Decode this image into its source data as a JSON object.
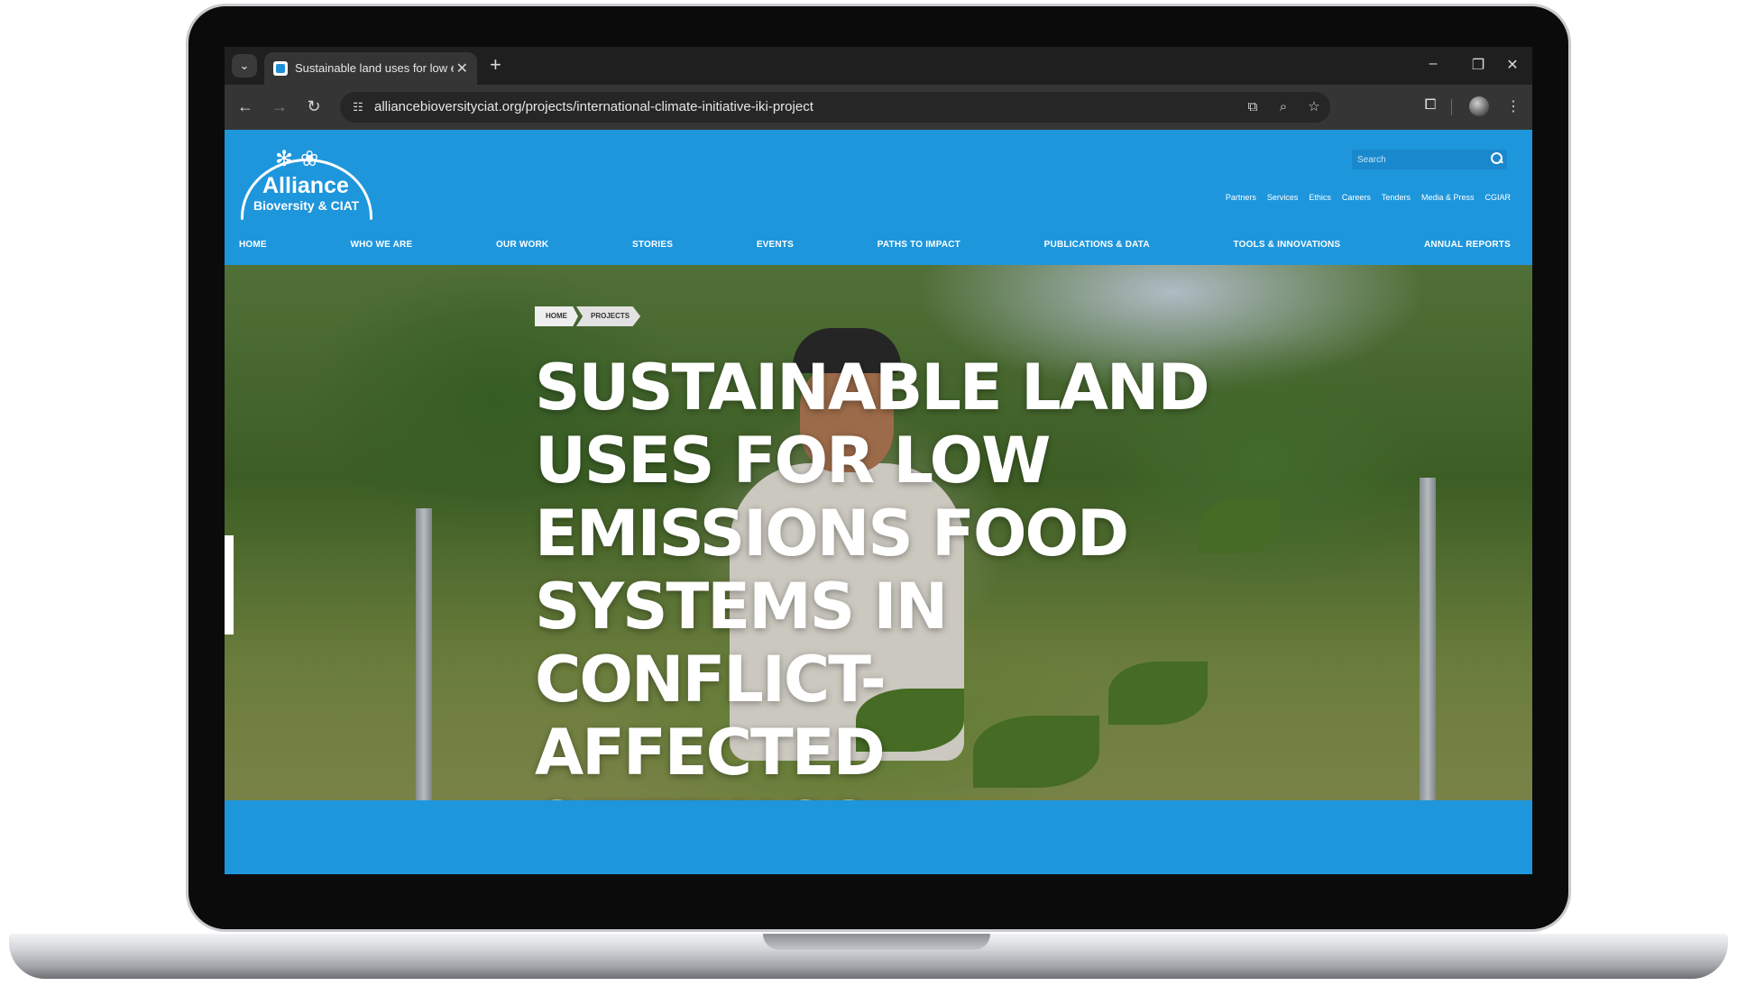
{
  "browser": {
    "tab_title": "Sustainable land uses for low em",
    "url": "alliancebioversityciat.org/projects/international-climate-initiative-iki-project",
    "icons": [
      "tab-search-icon",
      "close-icon",
      "plus-icon",
      "minimize-icon",
      "restore-icon",
      "close-window-icon",
      "back-icon",
      "forward-icon",
      "reload-icon",
      "site-info-icon",
      "translate-icon",
      "zoom-icon",
      "star-icon",
      "extensions-icon",
      "profile-icon",
      "more-icon"
    ]
  },
  "site": {
    "logo_name": "Alliance",
    "logo_sub": "Bioversity & CIAT",
    "search_placeholder": "Search",
    "util_nav": [
      "Partners",
      "Services",
      "Ethics",
      "Careers",
      "Tenders",
      "Media & Press",
      "CGIAR"
    ],
    "main_nav": [
      "HOME",
      "WHO WE ARE",
      "OUR WORK",
      "STORIES",
      "EVENTS",
      "PATHS TO IMPACT",
      "PUBLICATIONS & DATA",
      "TOOLS & INNOVATIONS",
      "ANNUAL REPORTS"
    ],
    "breadcrumb": [
      "HOME",
      "PROJECTS"
    ],
    "hero_title": "SUSTAINABLE LAND USES FOR LOW EMISSIONS FOOD SYSTEMS IN CONFLICT-AFFECTED SETTINGS"
  },
  "colors": {
    "brand_blue": "#1e96dc",
    "browser_dark": "#1f1f1f"
  }
}
